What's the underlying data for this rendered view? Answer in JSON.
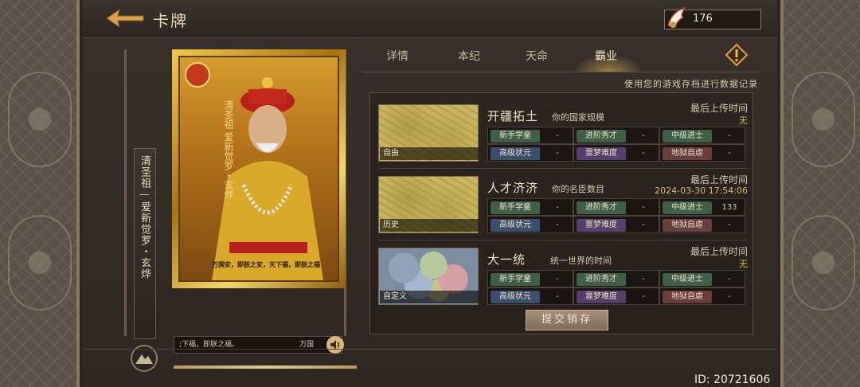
{
  "header": {
    "title": "卡牌",
    "currency_value": "176"
  },
  "card": {
    "vertical_name": "清圣祖—爱新觉罗・玄烨",
    "card_title": "清圣祖",
    "card_name": "爱新觉罗・玄烨",
    "card_caption": "万国安，即朕之安，天下福，即朕之福",
    "quote_text": ";下福，即朕之福。",
    "quote_suffix": "万国",
    "seal_color": "#c23a1c"
  },
  "tabs": [
    {
      "label": "详情",
      "active": false
    },
    {
      "label": "本纪",
      "active": false
    },
    {
      "label": "天命",
      "active": false
    },
    {
      "label": "霸业",
      "active": true
    }
  ],
  "subtitle": "使用您的游戏存档进行数据记录",
  "records": [
    {
      "map_label": "自由",
      "title": "开疆拓土",
      "desc": "你的国家规模",
      "upload_label": "最后上传时间",
      "upload_value": "无",
      "difficulties": [
        {
          "label": "新手学童",
          "value": "-",
          "color": "green"
        },
        {
          "label": "进阶秀才",
          "value": "-",
          "color": "green"
        },
        {
          "label": "中级进士",
          "value": "-",
          "color": "green"
        },
        {
          "label": "高级状元",
          "value": "-",
          "color": "blue"
        },
        {
          "label": "噩梦难度",
          "value": "-",
          "color": "purple"
        },
        {
          "label": "地狱自虐",
          "value": "-",
          "color": "red"
        }
      ]
    },
    {
      "map_label": "历史",
      "title": "人才济济",
      "desc": "你的名臣数目",
      "upload_label": "最后上传时间",
      "upload_value": "2024-03-30   17:54:06",
      "difficulties": [
        {
          "label": "新手学童",
          "value": "-",
          "color": "green"
        },
        {
          "label": "进阶秀才",
          "value": "-",
          "color": "green"
        },
        {
          "label": "中级进士",
          "value": "133",
          "color": "green"
        },
        {
          "label": "高级状元",
          "value": "-",
          "color": "blue"
        },
        {
          "label": "噩梦难度",
          "value": "-",
          "color": "purple"
        },
        {
          "label": "地狱自虐",
          "value": "-",
          "color": "red"
        }
      ]
    },
    {
      "map_label": "自定义",
      "title": "大一统",
      "desc": "统一世界的时间",
      "upload_label": "最后上传时间",
      "upload_value": "无",
      "difficulties": [
        {
          "label": "新手学童",
          "value": "-",
          "color": "green"
        },
        {
          "label": "进阶秀才",
          "value": "-",
          "color": "green"
        },
        {
          "label": "中级进士",
          "value": "-",
          "color": "green"
        },
        {
          "label": "高级状元",
          "value": "-",
          "color": "blue"
        },
        {
          "label": "噩梦难度",
          "value": "-",
          "color": "purple"
        },
        {
          "label": "地狱自虐",
          "value": "-",
          "color": "red"
        }
      ]
    }
  ],
  "submit_label": "提交销存",
  "player_id": "ID: 20721606",
  "icons": {
    "back": "arrow-left-icon",
    "currency": "feather-token-icon",
    "alert": "exclamation-diamond-icon",
    "speaker": "speaker-icon",
    "mountain": "mountain-emblem-icon"
  },
  "colors": {
    "accent_gold": "#d9b768",
    "badge_green": "#3f5f48",
    "badge_blue": "#3b4f6b",
    "badge_purple": "#56406b",
    "badge_red": "#6b3e3e"
  }
}
